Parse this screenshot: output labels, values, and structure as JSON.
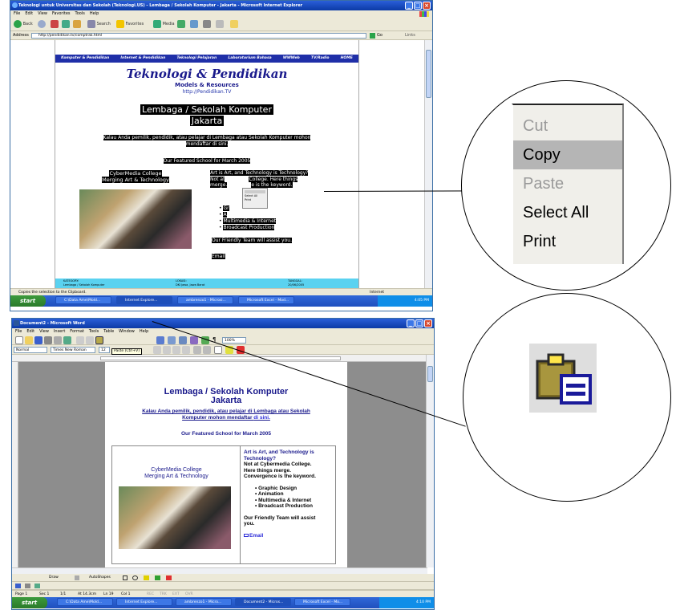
{
  "ie": {
    "title": "Teknologi untuk Universitas dan Sekolah (Teknologi.US) - Lembaga / Sekolah Komputer - Jakarta - Microsoft Internet Explorer",
    "menu": [
      "File",
      "Edit",
      "View",
      "Favorites",
      "Tools",
      "Help"
    ],
    "toolbar": {
      "back": "Back",
      "search": "Search",
      "favorites": "Favorites",
      "media": "Media"
    },
    "address_label": "Address",
    "address_value": "http://pendidikan.tv/comptrak.html",
    "go_label": "Go",
    "links_label": "Links",
    "nav_links": [
      "Komputer & Pendidikan",
      "Internet & Pendidikan",
      "Teknologi Pelajaran",
      "Laboratorium Bahasa",
      "WWWeb",
      "TV/Radio",
      "HOME"
    ],
    "site_title": "Teknologi & Pendidikan",
    "site_subtitle": "Models & Resources",
    "site_url": "http://Pendidikan.TV",
    "heading_line1": "Lembaga / Sekolah Komputer",
    "heading_line2": "Jakarta",
    "intro_line1": "Kalau Anda pemilik, pendidik, atau pelajar di Lembaga atau Sekolah Komputer mohon",
    "intro_line2": "mendaftar di sini.",
    "featured": "Our Featured School for March 2005",
    "school_line1": "CyberMedia College",
    "school_line2": "Merging Art & Technology",
    "desc_line1": "Art is Art, and Technology is Technology?",
    "desc_line2_a": "Not at",
    "desc_line2_b": "College. Here things",
    "desc_line3_a": "merge.",
    "desc_line3_b": "e is the keyword.",
    "bullets": [
      "Gr",
      "A",
      "Multimedia & Internet",
      "Broadcast Production"
    ],
    "team": "Our Friendly Team will assist you.",
    "email": "Email",
    "context_menu": [
      "Select All",
      "Print"
    ],
    "bottom_table": {
      "headers": [
        "KATEGORY:",
        "LOKASI:",
        "TANGGAL:"
      ],
      "values": [
        "Lembaga / Sekolah Komputer",
        "DKI Jawa, Jawa Barat",
        "20/06/2005"
      ]
    },
    "status_text": "Copies the selection to the Clipboard.",
    "status_zone": "Internet"
  },
  "taskbar1": {
    "start": "start",
    "items": [
      "C:\\Data Ame\\Mold...",
      "Internet Explore...",
      "ambrenzo1 - Microsi...",
      "Microsoft Excel - Mod..."
    ],
    "clock": "4:05 PM"
  },
  "word": {
    "title": "Document2 - Microsoft Word",
    "menu": [
      "File",
      "Edit",
      "View",
      "Insert",
      "Format",
      "Tools",
      "Table",
      "Window",
      "Help"
    ],
    "style_value": "Normal",
    "font_value": "Times New Roman",
    "size_value": "12",
    "zoom_value": "100%",
    "tooltip": "Paste (Ctrl+V)",
    "heading_line1": "Lembaga / Sekolah Komputer",
    "heading_line2": "Jakarta",
    "intro_line1": "Kalau Anda pemilik, pendidik, atau pelajar di Lembaga atau Sekolah",
    "intro_line2_a": "Komputer mohon mendaftar ",
    "intro_line2_b": "di sini.",
    "featured": "Our Featured School for March 2005",
    "school_line1": "CyberMedia College",
    "school_line2": "Merging Art & Technology",
    "desc_line1": "Art is Art, and Technology is",
    "desc_line2": "Technology?",
    "desc_line3": "Not at Cybermedia College.",
    "desc_line4": "Here things merge.",
    "desc_line5": "Convergence is the keyword.",
    "bullets": [
      "Graphic Design",
      "Animation",
      "Multimedia & Internet",
      "Broadcast Production"
    ],
    "team_line1": "Our Friendly Team will assist",
    "team_line2": "you.",
    "email": "Email",
    "draw_label": "Draw",
    "autoshapes_label": "AutoShapes",
    "status": [
      "Page 1",
      "Sec 1",
      "1/1",
      "At 14.3cm",
      "Ln 19",
      "Col 1",
      "REC",
      "TRK",
      "EXT",
      "OVR"
    ]
  },
  "taskbar2": {
    "start": "start",
    "items": [
      "C:\\Data Ame\\Mold...",
      "Internet Explore...",
      "ambrenzo1 - Micro...",
      "Document2 - Micros...",
      "Microsoft Excel - Mo..."
    ],
    "clock": "4:10 PM"
  },
  "zoom_menu": {
    "items": [
      "Cut",
      "Copy",
      "Paste",
      "Select All",
      "Print"
    ]
  },
  "colors": {
    "xp_blue": "#2a5ed8",
    "navy_text": "#1a1a8c",
    "nav_bar": "#1f2fa8",
    "menu_highlight": "#b5b5b5",
    "disabled": "#9a9a9a"
  }
}
